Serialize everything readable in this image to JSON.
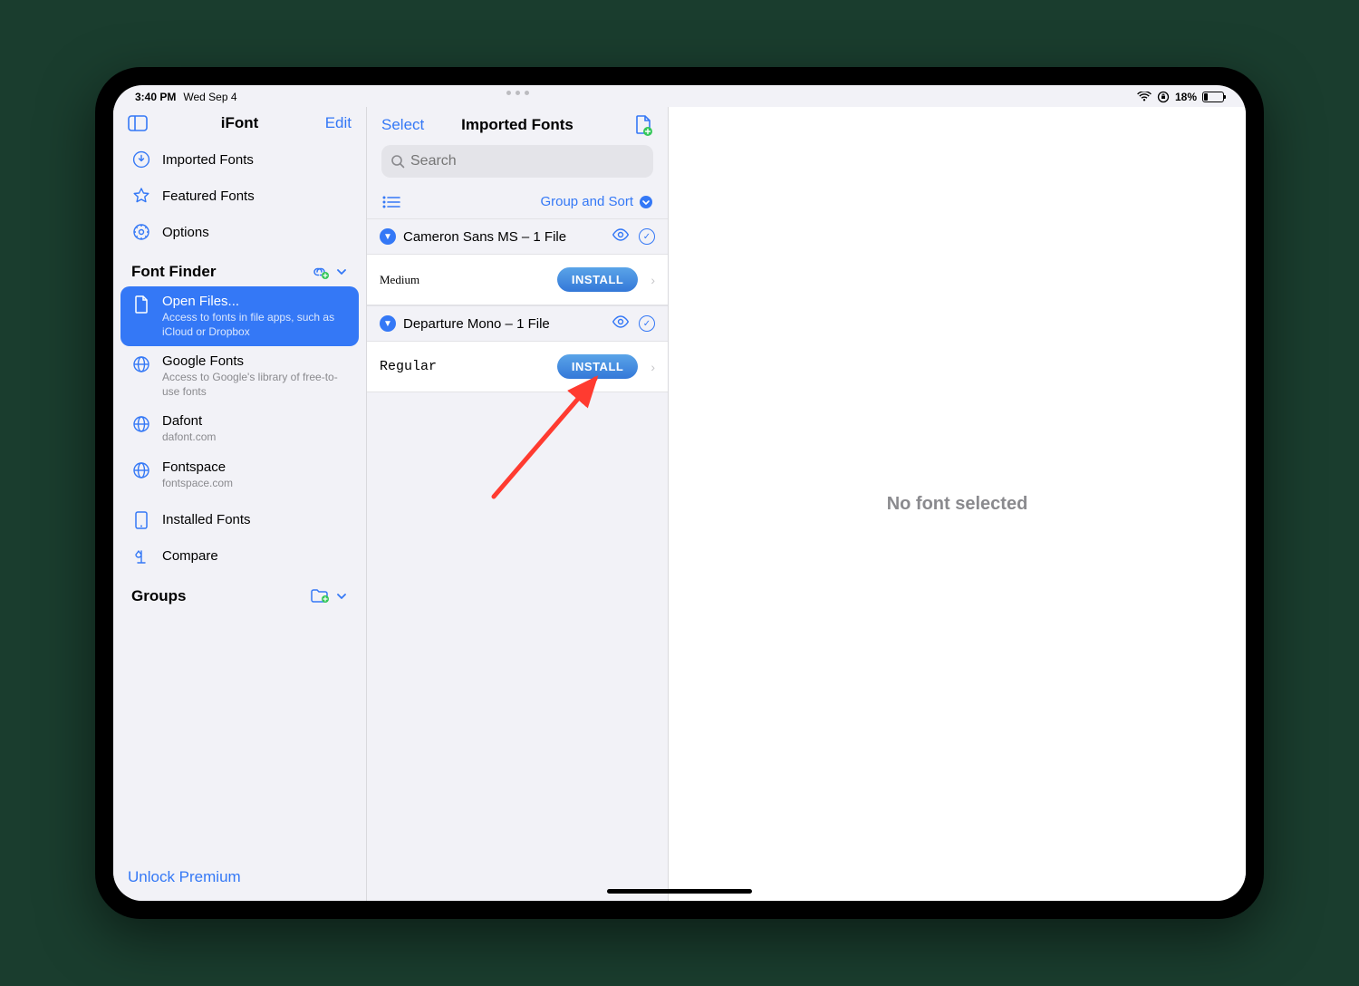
{
  "status": {
    "time": "3:40 PM",
    "date": "Wed Sep 4",
    "battery_pct": "18%"
  },
  "sidebar": {
    "title": "iFont",
    "edit": "Edit",
    "items": {
      "imported": "Imported Fonts",
      "featured": "Featured Fonts",
      "options": "Options",
      "installed": "Installed Fonts",
      "compare": "Compare"
    },
    "section_font_finder": "Font Finder",
    "section_groups": "Groups",
    "finder": {
      "open_files": {
        "title": "Open Files...",
        "desc": "Access to fonts in file apps, such as iCloud or Dropbox"
      },
      "google": {
        "title": "Google Fonts",
        "desc": "Access to Google's library of free-to-use fonts"
      },
      "dafont": {
        "title": "Dafont",
        "desc": "dafont.com"
      },
      "fontspace": {
        "title": "Fontspace",
        "desc": "fontspace.com"
      }
    },
    "footer": "Unlock Premium"
  },
  "mid": {
    "select": "Select",
    "title": "Imported Fonts",
    "search_placeholder": "Search",
    "group_sort": "Group and Sort",
    "groups": [
      {
        "name": "Cameron Sans MS – 1 File",
        "variant": "Medium",
        "variant_class": "cursive",
        "install": "INSTALL"
      },
      {
        "name": "Departure Mono – 1 File",
        "variant": "Regular",
        "variant_class": "mono",
        "install": "INSTALL"
      }
    ]
  },
  "detail": {
    "empty": "No font selected"
  }
}
